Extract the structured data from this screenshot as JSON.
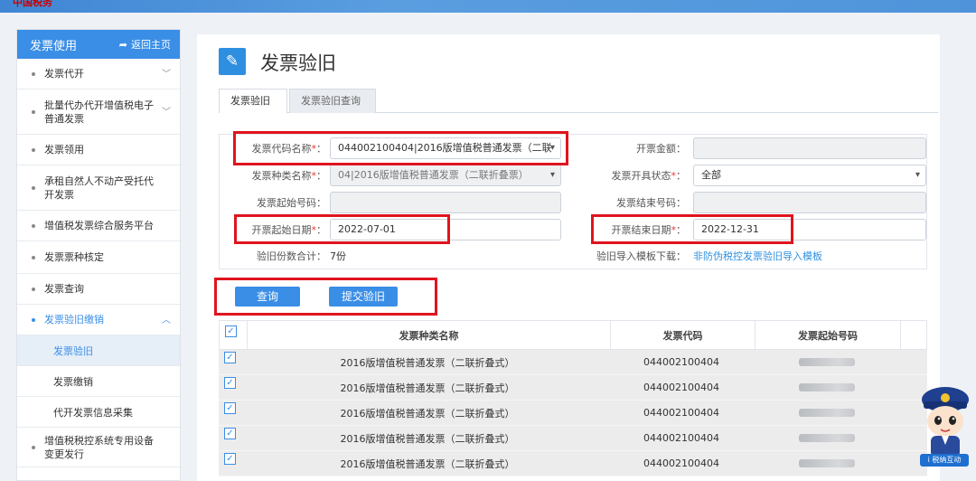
{
  "topbar": {
    "logo": "中国税务"
  },
  "sidebar": {
    "header": "发票使用",
    "home_label": "返回主页",
    "items": [
      {
        "label": "发票代开"
      },
      {
        "label": "批量代办代开增值税电子普通发票"
      },
      {
        "label": "发票领用"
      },
      {
        "label": "承租自然人不动产受托代开发票"
      },
      {
        "label": "增值税发票综合服务平台"
      },
      {
        "label": "发票票种核定"
      },
      {
        "label": "发票查询"
      },
      {
        "label": "发票验旧缴销"
      }
    ],
    "subitems": [
      {
        "label": "发票验旧"
      },
      {
        "label": "发票缴销"
      },
      {
        "label": "代开发票信息采集"
      }
    ],
    "last_item": {
      "label": "增值税税控系统专用设备变更发行"
    }
  },
  "page": {
    "title": "发票验旧"
  },
  "tabs": [
    {
      "label": "发票验旧"
    },
    {
      "label": "发票验旧查询"
    }
  ],
  "form": {
    "code_label": "发票代码名称",
    "code_value": "044002100404|2016版增值税普通发票（二联",
    "amount_label": "开票金额：",
    "type_label": "发票种类名称",
    "type_value": "04|2016版增值税普通发票（二联折叠票）",
    "status_label": "发票开具状态",
    "status_value": "全部",
    "start_no_label": "发票起始号码：",
    "end_no_label": "发票结束号码：",
    "start_date_label": "开票起始日期",
    "start_date_value": "2022-07-01",
    "end_date_label": "开票结束日期",
    "end_date_value": "2022-12-31",
    "count_label": "验旧份数合计：",
    "count_value": "7份",
    "template_label": "验旧导入模板下载：",
    "template_link": "非防伪税控发票验旧导入模板",
    "required_mark": "*",
    "colon": "："
  },
  "buttons": {
    "query": "查询",
    "submit": "提交验旧"
  },
  "table": {
    "headers": [
      "发票种类名称",
      "发票代码",
      "发票起始号码"
    ],
    "rows": [
      {
        "name": "2016版增值税普通发票（二联折叠式）",
        "code": "044002100404"
      },
      {
        "name": "2016版增值税普通发票（二联折叠式）",
        "code": "044002100404"
      },
      {
        "name": "2016版增值税普通发票（二联折叠式）",
        "code": "044002100404"
      },
      {
        "name": "2016版增值税普通发票（二联折叠式）",
        "code": "044002100404"
      },
      {
        "name": "2016版增值税普通发票（二联折叠式）",
        "code": "044002100404"
      }
    ]
  },
  "mascot": {
    "badge": "i 税纳互动"
  }
}
